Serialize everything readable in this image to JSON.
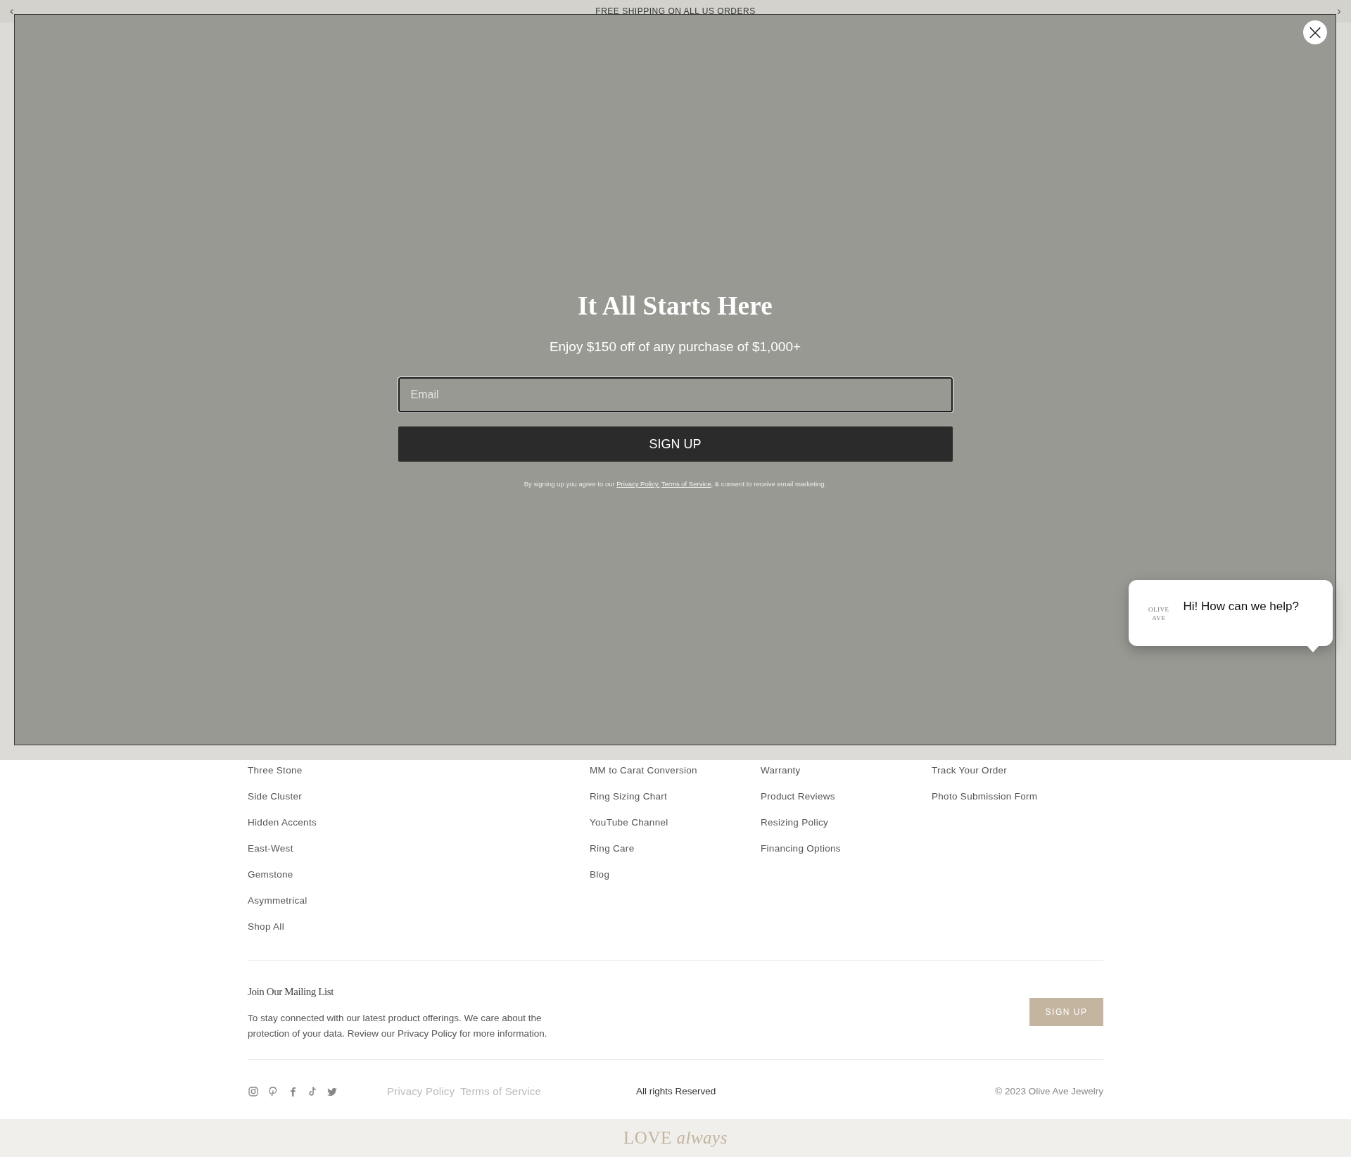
{
  "announcement": {
    "text": "FREE SHIPPING ON ALL US ORDERS",
    "prev": "‹",
    "next": "›"
  },
  "modal": {
    "close": "×",
    "title": "It All Starts Here",
    "subtitle": "Enjoy $150 off of any purchase of $1,000+",
    "email": {
      "placeholder": "Email"
    },
    "button": "SIGN UP",
    "disclaimer": {
      "before": "By signing up you agree to our ",
      "links": [
        "Privacy Policy,",
        "Terms of Service"
      ],
      "after": ", & consent to receive email marketing."
    }
  },
  "chat": {
    "logo_lines": [
      "OLIVE",
      "AVE"
    ],
    "message": "Hi! How can we help?"
  },
  "footer": {
    "columns": [
      {
        "links": [
          "Three Stone",
          "Side Cluster",
          "Hidden Accents",
          "East-West",
          "Gemstone",
          "Asymmetrical",
          "Shop All"
        ]
      },
      {},
      {
        "links": [
          "MM to Carat Conversion",
          "Ring Sizing Chart",
          "YouTube Channel",
          "Ring Care",
          "Blog"
        ]
      },
      {
        "links": [
          "Warranty",
          "Product Reviews",
          "Resizing Policy",
          "Financing Options"
        ]
      },
      {
        "links": [
          "Track Your Order",
          "Photo Submission Form"
        ]
      }
    ],
    "mailing": {
      "title": "Join Our Mailing List",
      "text": "To stay connected with our latest product offerings. We care about the protection of your data. Review our Privacy Policy for more information.",
      "button": "SIGN UP"
    },
    "social": [
      {
        "kind": "instagram"
      },
      {
        "kind": "pinterest"
      },
      {
        "kind": "facebook"
      },
      {
        "kind": "tiktok"
      },
      {
        "kind": "twitter"
      }
    ],
    "legal_links": [
      "Privacy Policy",
      "Terms of Service"
    ],
    "rights": "All rights Reserved",
    "copyright": "© 2023 Olive Ave Jewelry"
  },
  "banner": {
    "text": "LOVE *always*"
  }
}
